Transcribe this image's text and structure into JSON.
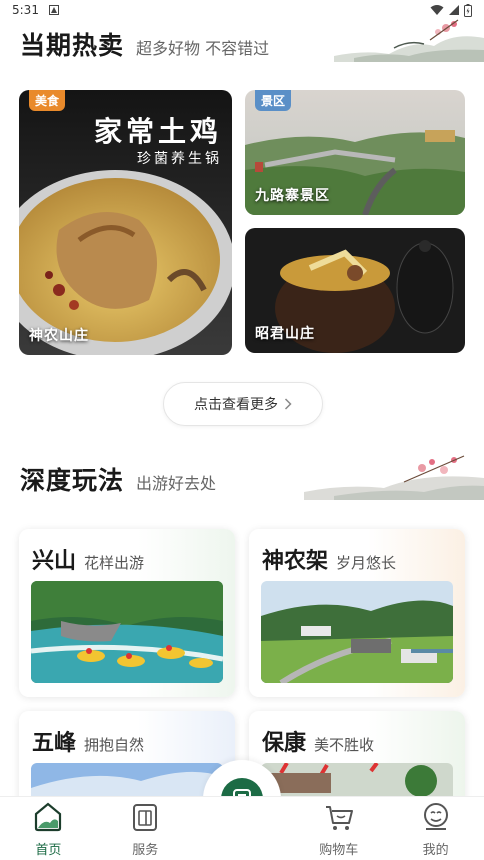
{
  "status": {
    "time": "5:31"
  },
  "hot": {
    "title": "当期热卖",
    "subtitle": "超多好物 不容错过",
    "cards": [
      {
        "tag": "美食",
        "tag_color": "#e98a2b",
        "overlay_title": "家常土鸡",
        "overlay_sub": "珍菌养生锅",
        "label": "神农山庄"
      },
      {
        "tag": "景区",
        "tag_color": "#5a8fc7",
        "label": "九路寨景区"
      },
      {
        "label": "昭君山庄"
      }
    ],
    "more_label": "点击查看更多"
  },
  "deep": {
    "title": "深度玩法",
    "subtitle": "出游好去处",
    "cards": [
      {
        "title": "兴山",
        "sub": "花样出游"
      },
      {
        "title": "神农架",
        "sub": "岁月悠长"
      },
      {
        "title": "五峰",
        "sub": "拥抱自然"
      },
      {
        "title": "保康",
        "sub": "美不胜收"
      }
    ]
  },
  "tabbar": {
    "items": [
      {
        "label": "首页",
        "icon": "home-icon"
      },
      {
        "label": "服务",
        "icon": "service-icon"
      },
      {
        "label": "购物车",
        "icon": "cart-icon"
      },
      {
        "label": "我的",
        "icon": "profile-icon"
      }
    ],
    "center_icon": "menu-list-icon",
    "accent": "#1c6b45"
  }
}
